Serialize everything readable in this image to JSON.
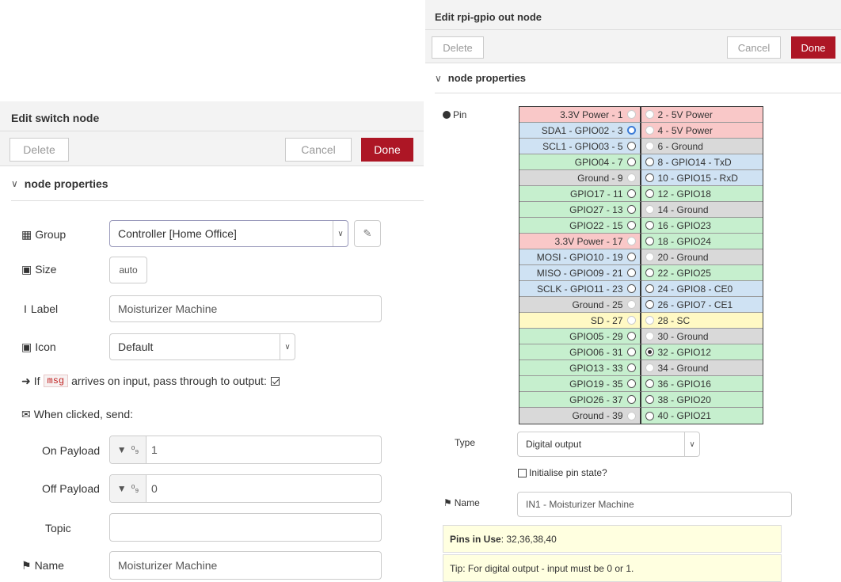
{
  "switch_node": {
    "title": "Edit switch node",
    "delete_label": "Delete",
    "cancel_label": "Cancel",
    "done_label": "Done",
    "section_label": "node properties",
    "group": {
      "label": "Group",
      "value": "Controller [Home Office]"
    },
    "size": {
      "label": "Size",
      "value": "auto"
    },
    "label": {
      "label": "Label",
      "value": "Moisturizer Machine"
    },
    "icon": {
      "label": "Icon",
      "value": "Default"
    },
    "passthrough": {
      "prefix": "If",
      "code": "msg",
      "suffix": "arrives on input, pass through to output:",
      "checked": true
    },
    "when_clicked_label": "When clicked, send:",
    "on_payload": {
      "label": "On Payload",
      "type": "⁰₉",
      "value": "1"
    },
    "off_payload": {
      "label": "Off Payload",
      "type": "⁰₉",
      "value": "0"
    },
    "topic": {
      "label": "Topic",
      "value": ""
    },
    "name": {
      "label": "Name",
      "value": "Moisturizer Machine"
    }
  },
  "gpio_node": {
    "title": "Edit rpi-gpio out node",
    "delete_label": "Delete",
    "cancel_label": "Cancel",
    "done_label": "Done",
    "section_label": "node properties",
    "pin_label": "Pin",
    "pins": [
      {
        "left": "3.3V Power - 1",
        "lc": "#f9c8c8",
        "lstate": "dis",
        "right": "2 - 5V Power",
        "rc": "#f9c8c8",
        "rstate": "dis"
      },
      {
        "left": "SDA1 - GPIO02 - 3",
        "lc": "#cfe2f3",
        "lstate": "hl",
        "right": "4 - 5V Power",
        "rc": "#f9c8c8",
        "rstate": "dis"
      },
      {
        "left": "SCL1 - GPIO03 - 5",
        "lc": "#cfe2f3",
        "lstate": "on",
        "right": "6 - Ground",
        "rc": "#d9d9d9",
        "rstate": "dis"
      },
      {
        "left": "GPIO04 - 7",
        "lc": "#c6efce",
        "lstate": "on",
        "right": "8 - GPIO14 - TxD",
        "rc": "#cfe2f3",
        "rstate": "on"
      },
      {
        "left": "Ground - 9",
        "lc": "#d9d9d9",
        "lstate": "dis",
        "right": "10 - GPIO15 - RxD",
        "rc": "#cfe2f3",
        "rstate": "on"
      },
      {
        "left": "GPIO17 - 11",
        "lc": "#c6efce",
        "lstate": "on",
        "right": "12 - GPIO18",
        "rc": "#c6efce",
        "rstate": "on"
      },
      {
        "left": "GPIO27 - 13",
        "lc": "#c6efce",
        "lstate": "on",
        "right": "14 - Ground",
        "rc": "#d9d9d9",
        "rstate": "dis"
      },
      {
        "left": "GPIO22 - 15",
        "lc": "#c6efce",
        "lstate": "on",
        "right": "16 - GPIO23",
        "rc": "#c6efce",
        "rstate": "on"
      },
      {
        "left": "3.3V Power - 17",
        "lc": "#f9c8c8",
        "lstate": "dis",
        "right": "18 - GPIO24",
        "rc": "#c6efce",
        "rstate": "on"
      },
      {
        "left": "MOSI - GPIO10 - 19",
        "lc": "#cfe2f3",
        "lstate": "on",
        "right": "20 - Ground",
        "rc": "#d9d9d9",
        "rstate": "dis"
      },
      {
        "left": "MISO - GPIO09 - 21",
        "lc": "#cfe2f3",
        "lstate": "on",
        "right": "22 - GPIO25",
        "rc": "#c6efce",
        "rstate": "on"
      },
      {
        "left": "SCLK - GPIO11 - 23",
        "lc": "#cfe2f3",
        "lstate": "on",
        "right": "24 - GPIO8 - CE0",
        "rc": "#cfe2f3",
        "rstate": "on"
      },
      {
        "left": "Ground - 25",
        "lc": "#d9d9d9",
        "lstate": "dis",
        "right": "26 - GPIO7 - CE1",
        "rc": "#cfe2f3",
        "rstate": "on"
      },
      {
        "left": "SD - 27",
        "lc": "#fff9c4",
        "lstate": "dis",
        "right": "28 - SC",
        "rc": "#fff9c4",
        "rstate": "dis"
      },
      {
        "left": "GPIO05 - 29",
        "lc": "#c6efce",
        "lstate": "on",
        "right": "30 - Ground",
        "rc": "#d9d9d9",
        "rstate": "dis"
      },
      {
        "left": "GPIO06 - 31",
        "lc": "#c6efce",
        "lstate": "on",
        "right": "32 - GPIO12",
        "rc": "#c6efce",
        "rstate": "sel"
      },
      {
        "left": "GPIO13 - 33",
        "lc": "#c6efce",
        "lstate": "on",
        "right": "34 - Ground",
        "rc": "#d9d9d9",
        "rstate": "dis"
      },
      {
        "left": "GPIO19 - 35",
        "lc": "#c6efce",
        "lstate": "on",
        "right": "36 - GPIO16",
        "rc": "#c6efce",
        "rstate": "on"
      },
      {
        "left": "GPIO26 - 37",
        "lc": "#c6efce",
        "lstate": "on",
        "right": "38 - GPIO20",
        "rc": "#c6efce",
        "rstate": "on"
      },
      {
        "left": "Ground - 39",
        "lc": "#d9d9d9",
        "lstate": "dis",
        "right": "40 - GPIO21",
        "rc": "#c6efce",
        "rstate": "on"
      }
    ],
    "type": {
      "label": "Type",
      "value": "Digital output"
    },
    "init_label": "Initialise pin state?",
    "name": {
      "label": "Name",
      "value": "IN1 - Moisturizer Machine"
    },
    "pins_in_use": {
      "label": "Pins in Use",
      "value": ": 32,36,38,40"
    },
    "tip": "Tip: For digital output - input must be 0 or 1."
  }
}
